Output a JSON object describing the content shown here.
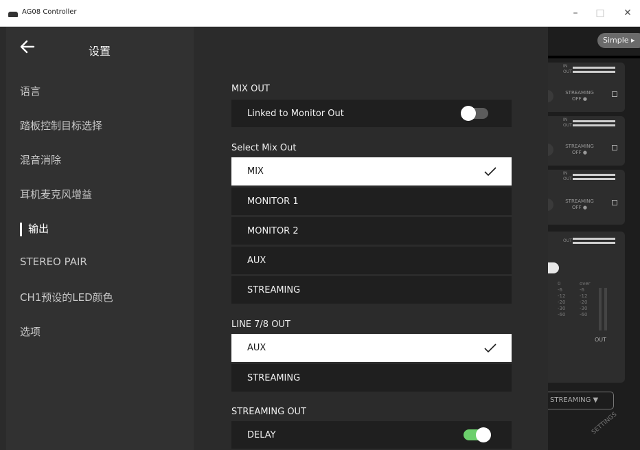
{
  "window": {
    "title": "AG08 Controller",
    "minimize_glyph": "–",
    "maximize_glyph": "□",
    "close_glyph": "✕"
  },
  "sidebar": {
    "title": "设置",
    "items": [
      {
        "label": "语言",
        "active": false
      },
      {
        "label": "踏板控制目标选择",
        "active": false
      },
      {
        "label": "混音消除",
        "active": false
      },
      {
        "label": "耳机麦克风增益",
        "active": false
      },
      {
        "label": "输出",
        "active": true
      },
      {
        "label": "STEREO PAIR",
        "active": false
      },
      {
        "label": "CH1预设的LED颜色",
        "active": false
      },
      {
        "label": "选项",
        "active": false
      }
    ]
  },
  "main": {
    "mix_out": {
      "label": "MIX OUT",
      "linked_label": "Linked to Monitor Out",
      "linked_on": false
    },
    "select_mix_out": {
      "label": "Select Mix Out",
      "options": [
        "MIX",
        "MONITOR 1",
        "MONITOR 2",
        "AUX",
        "STREAMING"
      ],
      "selected": "MIX"
    },
    "line78_out": {
      "label": "LINE 7/8 OUT",
      "options": [
        "AUX",
        "STREAMING"
      ],
      "selected": "AUX"
    },
    "streaming_out": {
      "label": "STREAMING OUT",
      "delay_label": "DELAY",
      "delay_on": true
    }
  },
  "background_app": {
    "simple_button": "Simple ▸",
    "meter_in": "IN",
    "meter_out": "OUT",
    "streaming_label": "STREAMING",
    "streaming_state": "OFF ●",
    "scale_left": [
      "0",
      "-6",
      "-12",
      "-20",
      "-30",
      "-60"
    ],
    "scale_right": [
      "over",
      "-6",
      "-12",
      "-20",
      "-30",
      "-60"
    ],
    "out_label": "OUT",
    "streaming_select": "STREAMING ▼",
    "settings_label": "SETTINGS"
  },
  "colors": {
    "toggle_on": "#6ccf6c",
    "row_bg": "#1f1f1f",
    "selected_bg": "#ffffff",
    "sidebar_bg": "#313131"
  }
}
